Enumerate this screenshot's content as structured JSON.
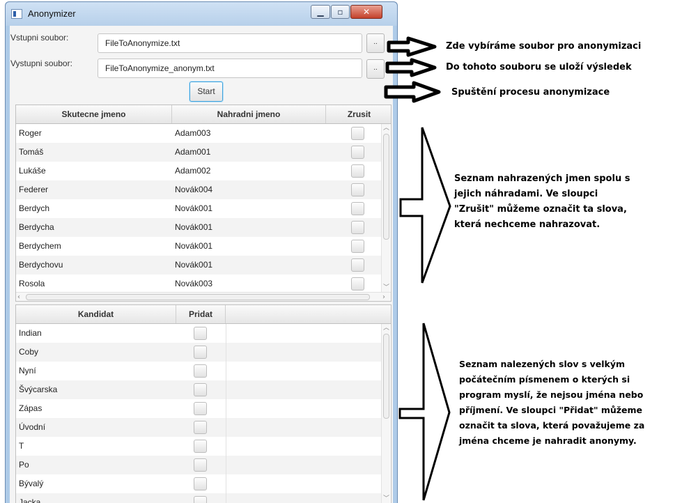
{
  "window": {
    "title": "Anonymizer"
  },
  "form": {
    "input_label": "Vstupni soubor:",
    "input_value": "FileToAnonymize.txt",
    "output_label": "Vystupni soubor:",
    "output_value": "FileToAnonymize_anonym.txt",
    "browse_label": "..",
    "start_label": "Start"
  },
  "names_table": {
    "columns": [
      "Skutecne jmeno",
      "Nahradni jmeno",
      "Zrusit"
    ],
    "rows": [
      {
        "real": "Roger",
        "replacement": "Adam003"
      },
      {
        "real": "Tomáš",
        "replacement": "Adam001"
      },
      {
        "real": "Lukáše",
        "replacement": "Adam002"
      },
      {
        "real": "Federer",
        "replacement": "Novák004"
      },
      {
        "real": "Berdych",
        "replacement": "Novák001"
      },
      {
        "real": "Berdycha",
        "replacement": "Novák001"
      },
      {
        "real": "Berdychem",
        "replacement": "Novák001"
      },
      {
        "real": "Berdychovu",
        "replacement": "Novák001"
      },
      {
        "real": "Rosola",
        "replacement": "Novák003"
      }
    ]
  },
  "candidates_table": {
    "columns": [
      "Kandidat",
      "Pridat"
    ],
    "rows": [
      "Indian",
      "Coby",
      "Nyní",
      "Švýcarska",
      "Zápas",
      "Úvodní",
      "T",
      "Po",
      "Bývalý",
      "Jacka"
    ]
  },
  "annotations": {
    "choose_file": "Zde vybíráme soubor pro anonymizaci",
    "output_file": "Do tohoto souboru se uloží výsledek",
    "start_process": "Spuštění procesu anonymizace",
    "names_list": [
      "Seznam nahrazených jmen spolu s",
      "jejich náhradami. Ve sloupci",
      "\"Zrušit\" můžeme označit ta slova,",
      "která nechceme nahrazovat."
    ],
    "candidates_list": [
      "Seznam nalezených slov s velkým",
      "počátečním písmenem o kterých si",
      "program myslí, že nejsou jména nebo",
      "příjmení. Ve sloupci \"Přidat\" můžeme",
      "označit ta slova, která považujeme za",
      "jména chceme je nahradit anonymy."
    ]
  }
}
